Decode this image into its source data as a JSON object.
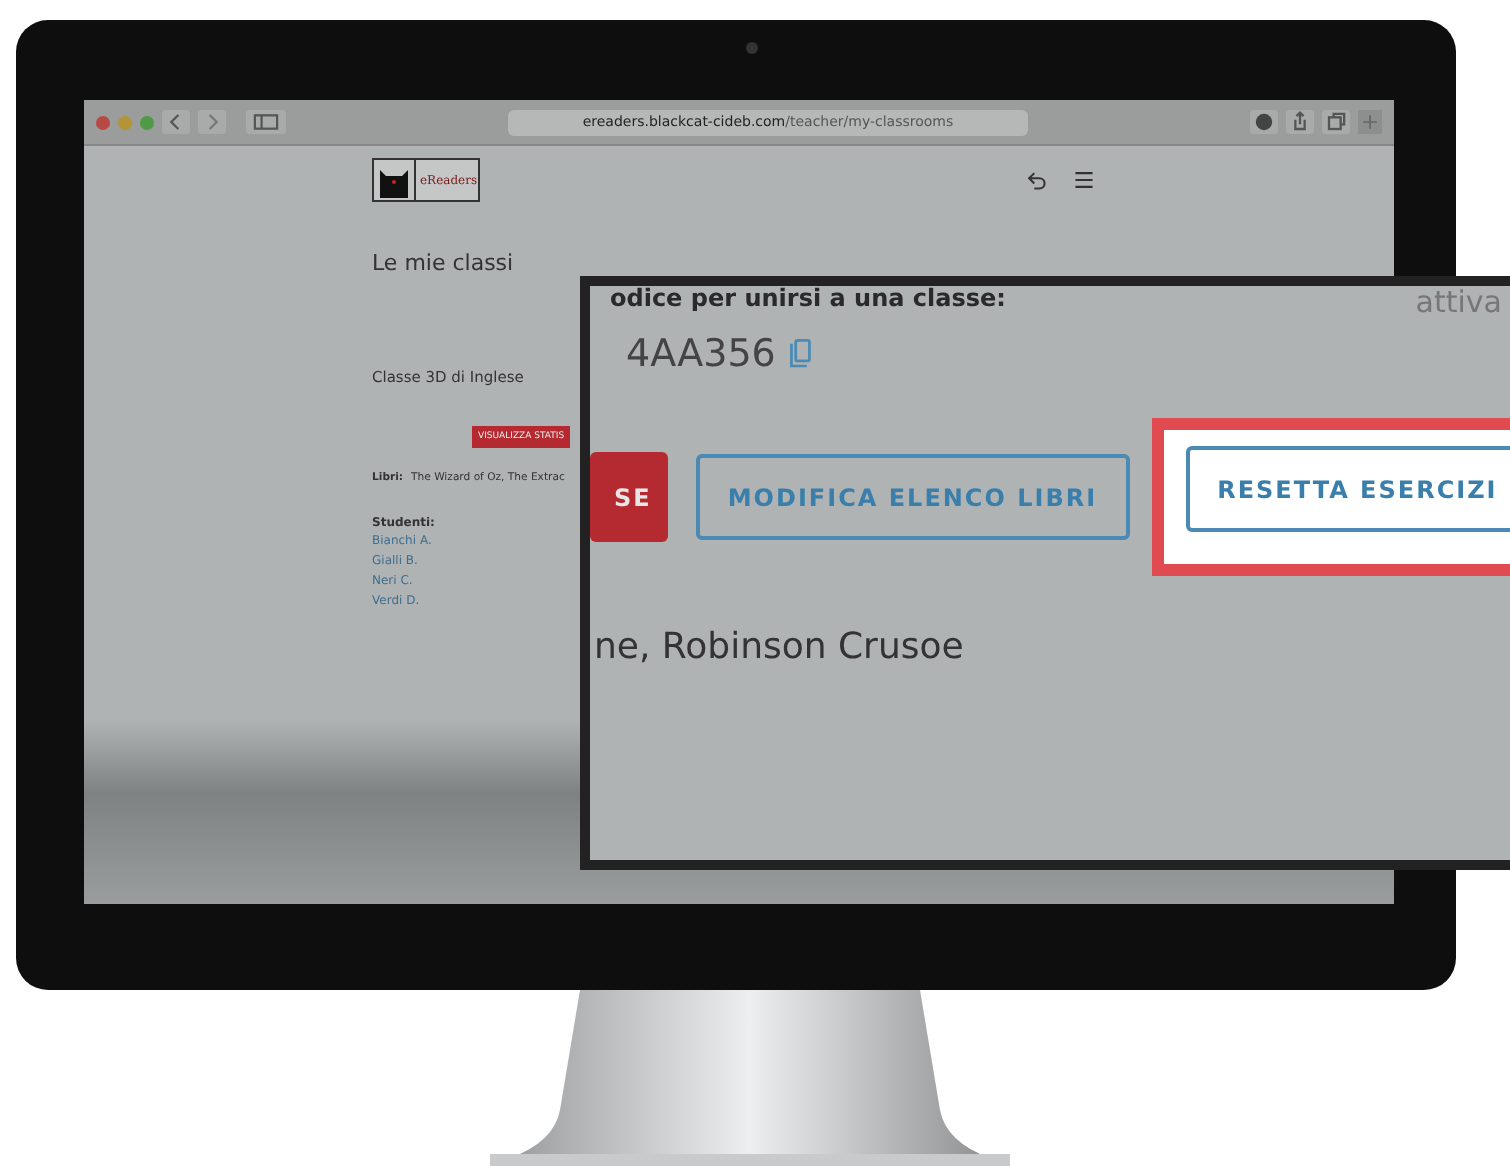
{
  "browser": {
    "url_host": "ereaders.blackcat-cideb.com",
    "url_path": "/teacher/my-classrooms"
  },
  "page": {
    "logo_text": "eReaders",
    "heading": "Le mie classi",
    "class_name": "Classe 3D di Inglese",
    "stats_button": "VISUALIZZA STATIS",
    "books_label": "Libri:",
    "books": "The Wizard of Oz, The Extrac",
    "students_label": "Studenti:",
    "students": [
      "Bianchi A.",
      "Gialli B.",
      "Neri C.",
      "Verdi D."
    ]
  },
  "inset": {
    "code_label": "odice per unirsi a una classe:",
    "code": "4AA356",
    "side_text": "attiva",
    "buttons": [
      {
        "label": "SE",
        "kind": "filled",
        "highlighted": false
      },
      {
        "label": "MODIFICA ELENCO LIBRI",
        "kind": "outline",
        "highlighted": false
      },
      {
        "label": "RESETTA ESERCIZI",
        "kind": "outline",
        "highlighted": true
      }
    ],
    "books": "ne, Robinson Crusoe"
  }
}
